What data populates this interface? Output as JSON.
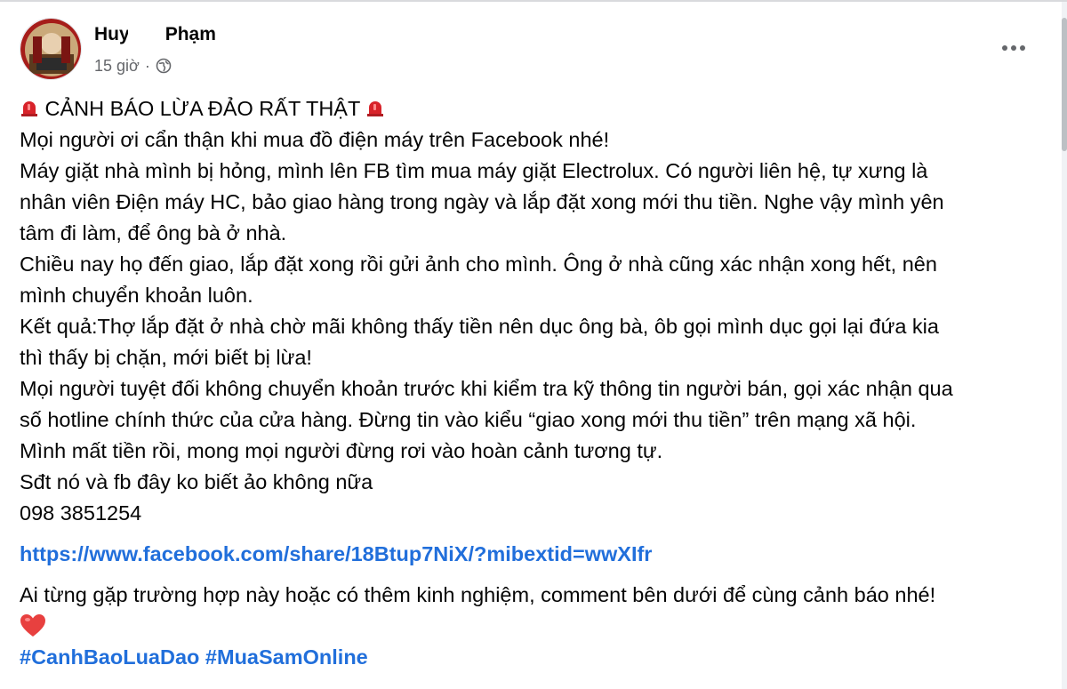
{
  "post": {
    "author_name": "Huyền Phạm",
    "author_visible_start": "Huy",
    "author_visible_end": "Phạm",
    "timestamp": "15 giờ",
    "separator": "·",
    "privacy_icon": "globe-icon",
    "more_icon": "more-horizontal-icon"
  },
  "content": {
    "title": "CẢNH BÁO LỪA ĐẢO RẤT THẬT",
    "title_icon": "siren-icon",
    "lines": [
      "Mọi người ơi cẩn thận khi mua đồ điện máy trên Facebook nhé!",
      "Máy giặt nhà mình bị hỏng, mình lên FB tìm mua máy giặt Electrolux. Có người liên hệ, tự xưng là",
      "nhân viên Điện máy HC, bảo giao hàng trong ngày và lắp đặt xong mới thu tiền. Nghe vậy mình yên",
      "tâm đi làm, để ông bà ở nhà.",
      "Chiều nay họ đến giao, lắp đặt xong rồi gửi ảnh cho mình. Ông ở nhà cũng xác nhận xong hết, nên",
      "mình chuyển khoản luôn.",
      "Kết quả:Thợ lắp đặt ở nhà chờ mãi không thấy tiền nên dục ông bà, ôb gọi mình dục gọi lại đứa kia",
      "thì thấy bị chặn, mới biết bị lừa!",
      "Mọi người tuyệt đối không chuyển khoản trước khi kiểm tra kỹ thông tin người bán, gọi xác nhận qua",
      "số hotline chính thức của cửa hàng. Đừng tin vào kiểu “giao xong mới thu tiền” trên mạng xã hội.",
      "Mình mất tiền rồi, mong mọi người đừng rơi vào hoàn cảnh tương tự.",
      "Sđt nó và fb đây ko biết ảo không nữa",
      "098 3851254"
    ],
    "link": "https://www.facebook.com/share/18Btup7NiX/?mibextid=wwXIfr",
    "closing": "Ai từng gặp trường hợp này hoặc có thêm kinh nghiệm, comment bên dưới để cùng cảnh báo nhé!",
    "heart_icon": "red-heart-icon",
    "hashtags": [
      "#CanhBaoLuaDao",
      "#MuaSamOnline"
    ]
  },
  "colors": {
    "text": "#050505",
    "muted": "#65676b",
    "link": "#216fdb",
    "alert_red": "#d8232a"
  }
}
